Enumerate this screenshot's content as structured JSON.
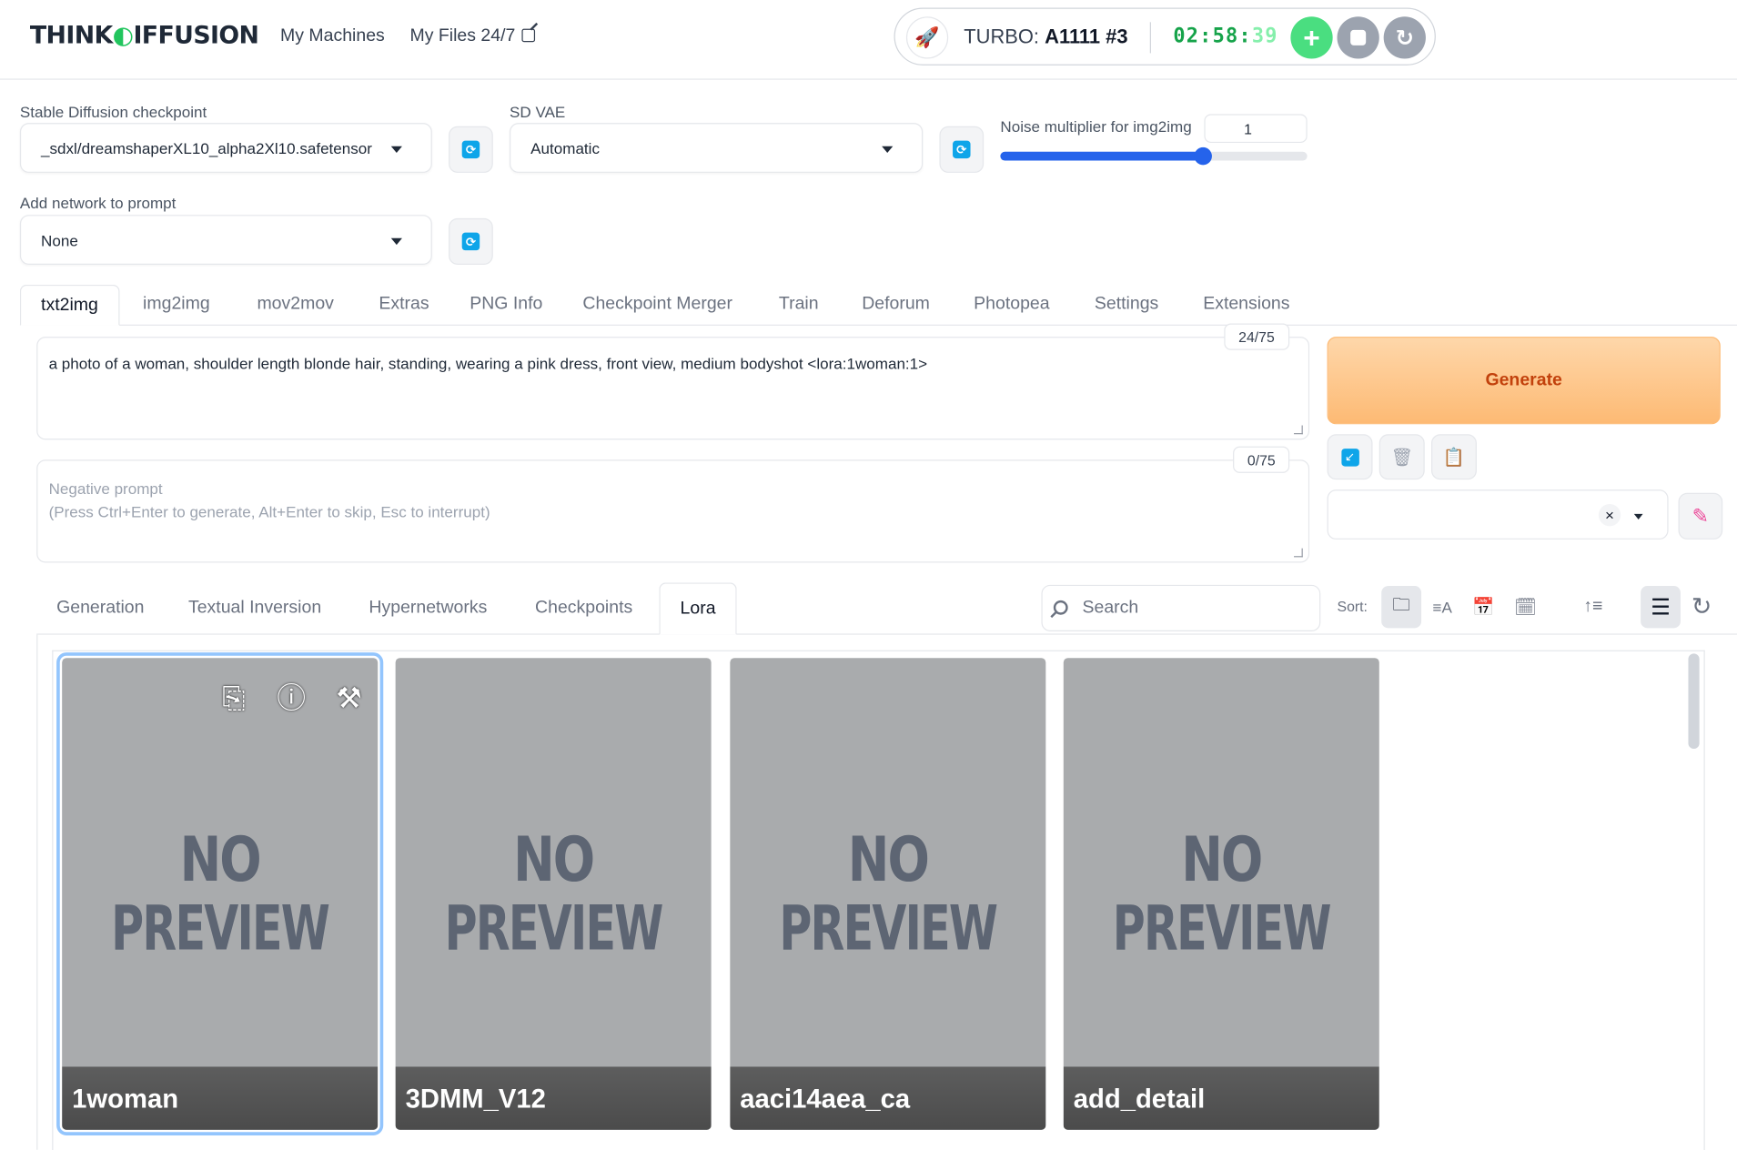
{
  "header": {
    "logo": "THINKDIFFUSION",
    "logo_left": "THINK",
    "logo_right": "IFFUSION",
    "nav": [
      "My Machines",
      "My Files 24/7"
    ],
    "turbo_label": "TURBO:",
    "turbo_machine": "A1111 #3",
    "timer_main": "02:58:",
    "timer_dim": "39"
  },
  "settings": {
    "checkpoint_label": "Stable Diffusion checkpoint",
    "checkpoint_value": "_sdxl/dreamshaperXL10_alpha2Xl10.safetensor",
    "vae_label": "SD VAE",
    "vae_value": "Automatic",
    "noise_label": "Noise multiplier for img2img",
    "noise_value": "1",
    "noise_fraction": 0.66,
    "network_label": "Add network to prompt",
    "network_value": "None"
  },
  "tabs": [
    "txt2img",
    "img2img",
    "mov2mov",
    "Extras",
    "PNG Info",
    "Checkpoint Merger",
    "Train",
    "Deforum",
    "Photopea",
    "Settings",
    "Extensions"
  ],
  "prompt": {
    "text": "a photo of a woman, shoulder length blonde hair, standing, wearing a pink dress, front view, medium bodyshot <lora:1woman:1>",
    "counter": "24/75",
    "negative_placeholder_1": "Negative prompt",
    "negative_placeholder_2": "(Press Ctrl+Enter to generate, Alt+Enter to skip, Esc to interrupt)",
    "negative_counter": "0/75"
  },
  "generate_label": "Generate",
  "network_tabs": [
    "Generation",
    "Textual Inversion",
    "Hypernetworks",
    "Checkpoints",
    "Lora"
  ],
  "search_placeholder": "Search",
  "sort_label": "Sort:",
  "cards": [
    {
      "name": "1woman",
      "np1": "NO",
      "np2": "PREVIEW"
    },
    {
      "name": "3DMM_V12",
      "np1": "NO",
      "np2": "PREVIEW"
    },
    {
      "name": "aaci14aea_ca",
      "np1": "NO",
      "np2": "PREVIEW"
    },
    {
      "name": "add_detail",
      "np1": "NO",
      "np2": "PREVIEW"
    }
  ],
  "colors": {
    "accent": "#2563eb",
    "brand_green": "#22c55e",
    "generate_text": "#c2410c",
    "refresh_icon": "#0ea5e9"
  }
}
